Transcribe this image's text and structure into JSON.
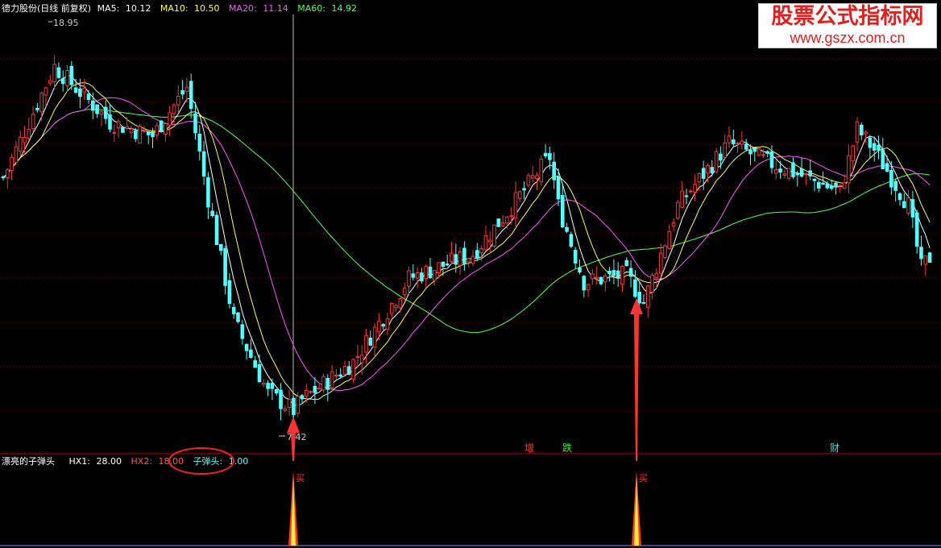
{
  "header": {
    "stock": "德力股份(日线 前复权)",
    "ma5_label": "MA5:",
    "ma5_value": "10.12",
    "ma10_label": "MA10:",
    "ma10_value": "10.50",
    "ma20_label": "MA20:",
    "ma20_value": "11.14",
    "ma60_label": "MA60:",
    "ma60_value": "14.92"
  },
  "price_labels": {
    "high": "18.95",
    "low": "7.42"
  },
  "event_markers": [
    {
      "text": "增",
      "color": "#ff3333"
    },
    {
      "text": "跌",
      "color": "#33ee33"
    },
    {
      "text": "财",
      "color": "#33dddd"
    }
  ],
  "indicator": {
    "name": "漂亮的子弹头",
    "hx1_label": "HX1:",
    "hx1_value": "28.00",
    "hx2_label": "HX2:",
    "hx2_value": "18.00",
    "bullet_label": "子弹头:",
    "bullet_value": "1.00",
    "buy_label": "买"
  },
  "watermark": {
    "line1": "股票公式指标网",
    "line2": "www.gszx.com.cn"
  },
  "colors": {
    "up": "#ff3333",
    "down": "#54ffff",
    "ma5": "#ffffff",
    "ma10": "#ffff54",
    "ma20": "#ff54ff",
    "ma60": "#54ff54",
    "panel_border": "#bb0000",
    "arrow": "#ff3333",
    "watermark_red": "#e0201e"
  }
}
